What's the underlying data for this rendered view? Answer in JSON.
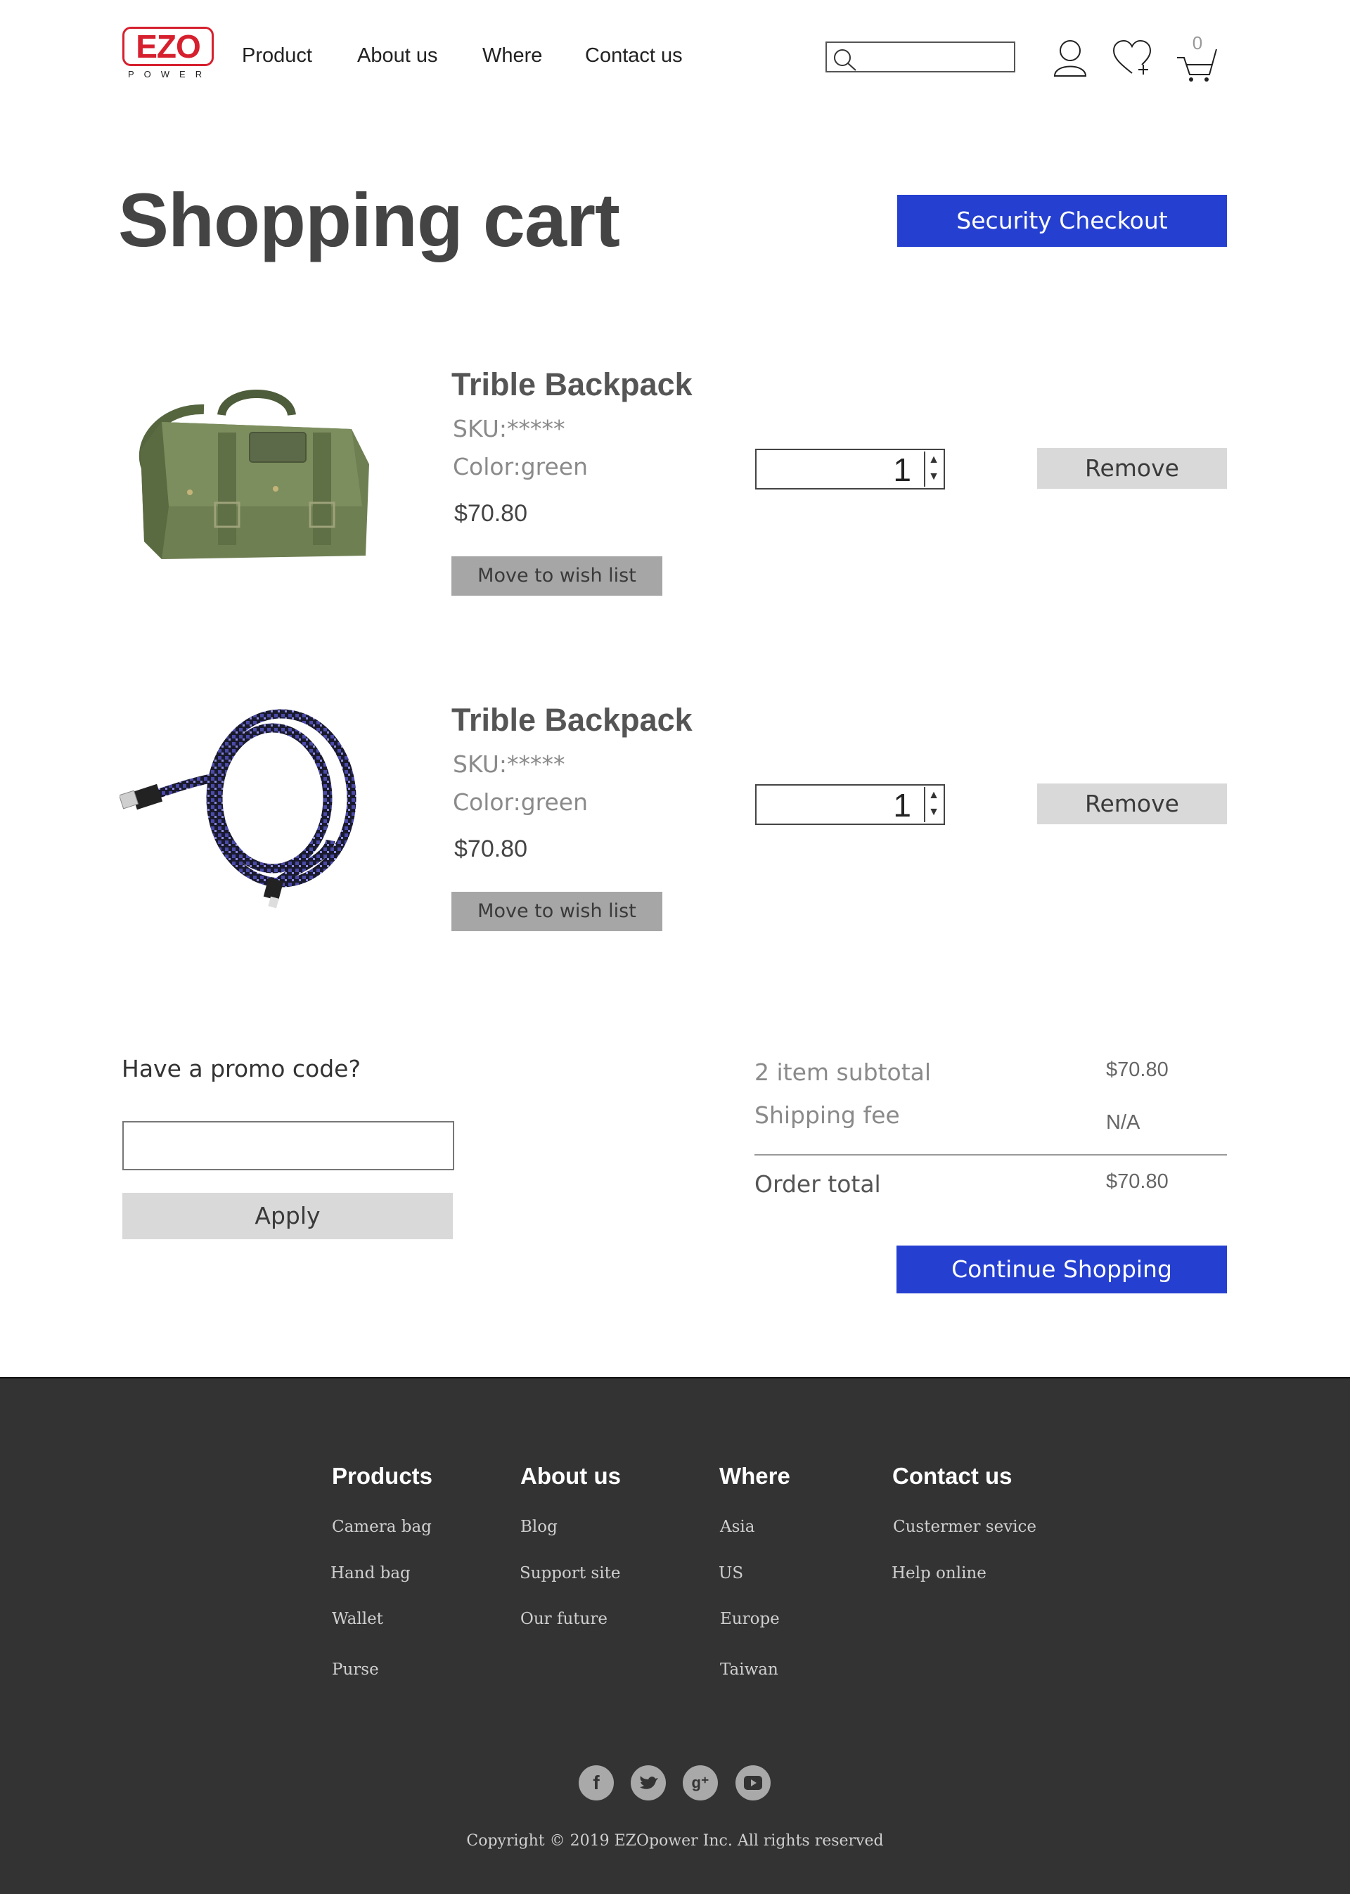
{
  "header": {
    "logo_text": "EZO",
    "logo_sub": "POWER",
    "nav": [
      "Product",
      "About us",
      "Where",
      "Contact us"
    ],
    "search_placeholder": "",
    "cart_count": "0",
    "brand_red": "#d6202e"
  },
  "page": {
    "title": "Shopping cart",
    "checkout_label": "Security Checkout",
    "accent": "#2540d0"
  },
  "items": [
    {
      "name": "Trible Backpack",
      "sku": "SKU:*****",
      "color": "Color:green",
      "price": "$70.80",
      "wish_label": "Move to wish list",
      "quantity": "1",
      "remove_label": "Remove",
      "image": "green-camera-bag"
    },
    {
      "name": "Trible Backpack",
      "sku": "SKU:*****",
      "color": "Color:green",
      "price": "$70.80",
      "wish_label": "Move to wish list",
      "quantity": "1",
      "remove_label": "Remove",
      "image": "braided-usb-cable"
    }
  ],
  "promo": {
    "label": "Have a promo code?",
    "input_value": "",
    "apply_label": "Apply"
  },
  "summary": {
    "subtotal_label": "2 item subtotal",
    "subtotal_value": "$70.80",
    "shipping_label": "Shipping fee",
    "shipping_value": "N/A",
    "total_label": "Order total",
    "total_value": "$70.80",
    "continue_label": "Continue Shopping"
  },
  "footer": {
    "columns": [
      {
        "heading": "Products",
        "links": [
          "Camera bag",
          "Hand bag",
          "Wallet",
          "Purse"
        ]
      },
      {
        "heading": "About us",
        "links": [
          "Blog",
          "Support site",
          "Our future"
        ]
      },
      {
        "heading": "Where",
        "links": [
          "Asia",
          "US",
          "Europe",
          "Taiwan"
        ]
      },
      {
        "heading": "Contact us",
        "links": [
          "Custermer sevice",
          "Help online"
        ]
      }
    ],
    "social_icons": [
      "facebook-icon",
      "twitter-icon",
      "google-plus-icon",
      "youtube-icon"
    ],
    "copyright": "Copyright © 2019 EZOpower  Inc. All rights reserved",
    "bg": "#333333"
  }
}
